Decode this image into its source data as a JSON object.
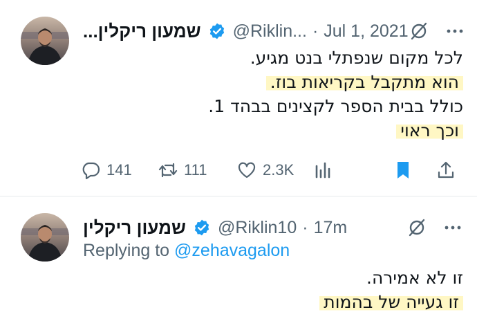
{
  "tweets": [
    {
      "author": {
        "name": "...שמעון ריקלין",
        "handle": "@Riklin...",
        "avatar": "user-avatar"
      },
      "time": "Jul 1, 2021",
      "lines": [
        "לכל מקום שנפתלי בנט מגיע.",
        "הוא מתקבל בקריאות בוז.",
        "כולל בבית הספר לקצינים בבהד 1.",
        "וכך ראוי"
      ],
      "stats": {
        "replies": "141",
        "retweets": "111",
        "likes": "2.3K"
      }
    },
    {
      "author": {
        "name": "שמעון ריקלין",
        "handle": "@Riklin10",
        "avatar": "user-avatar"
      },
      "time": "17m",
      "replying_to_prefix": "Replying to",
      "replying_to_handle": "@zehavagalon",
      "lines": [
        "זו לא אמירה.",
        "זו געייה של בהמות"
      ]
    }
  ],
  "colors": {
    "accent": "#1d9bf0",
    "secondary_text": "#536471",
    "highlight": "#fff7c4"
  }
}
